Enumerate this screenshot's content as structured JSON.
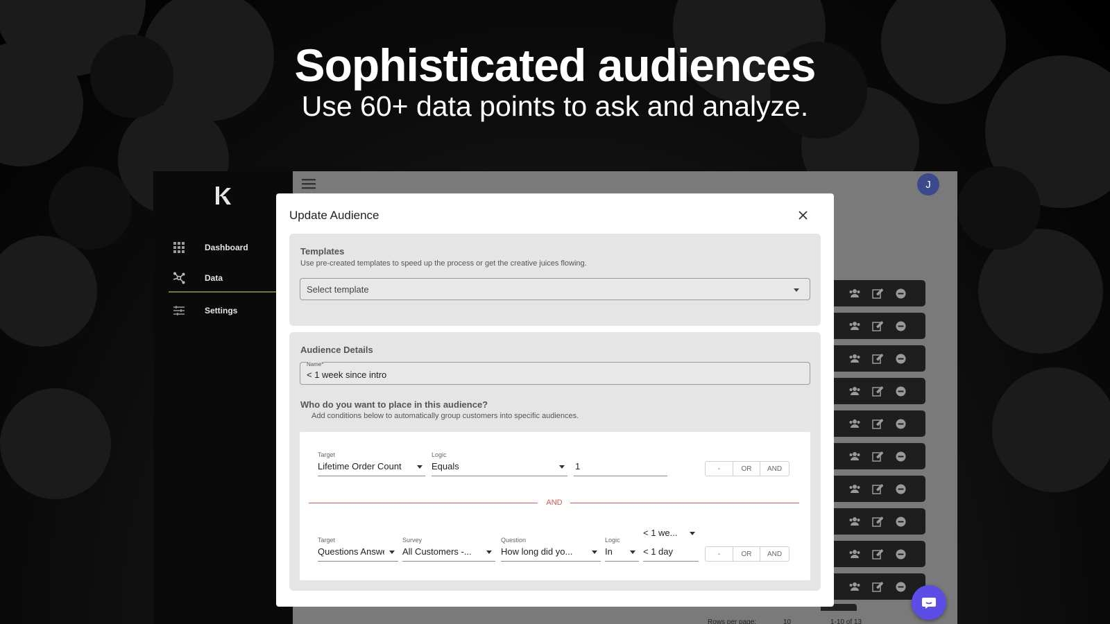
{
  "hero": {
    "title": "Sophisticated audiences",
    "subtitle": "Use 60+ data points to ask and analyze."
  },
  "sidebar": {
    "items": [
      {
        "label": "Dashboard",
        "icon": "dashboard-grid-icon"
      },
      {
        "label": "Data",
        "icon": "data-nodes-icon",
        "active": true
      },
      {
        "label": "Settings",
        "icon": "settings-sliders-icon"
      }
    ]
  },
  "header": {
    "avatar_initial": "J"
  },
  "list_rows": {
    "count": 10,
    "actions": [
      "users-icon",
      "edit-icon",
      "remove-icon"
    ]
  },
  "pagination": {
    "rows_per_page_label": "Rows per page:",
    "rows_per_page_value": "10",
    "range_text": "1-10 of 13"
  },
  "modal": {
    "title": "Update Audience",
    "templates": {
      "title": "Templates",
      "description": "Use pre-created templates to speed up the process or get the creative juices flowing.",
      "placeholder": "Select template"
    },
    "details": {
      "title": "Audience Details",
      "name_label": "Name*",
      "name_value": "< 1 week since intro",
      "question": "Who do you want to place in this audience?",
      "question_desc": "Add conditions below to automatically group customers into specific audiences."
    },
    "condition1": {
      "target_label": "Target",
      "target_value": "Lifetime Order Count",
      "logic_label": "Logic",
      "logic_value": "Equals",
      "value": "1",
      "buttons": [
        "-",
        "OR",
        "AND"
      ]
    },
    "connector": "AND",
    "condition2": {
      "target_label": "Target",
      "target_value": "Questions Answered",
      "survey_label": "Survey",
      "survey_value": "All Customers -...",
      "question_label": "Question",
      "question_value": "How long did yo...",
      "logic_label": "Logic",
      "logic_value": "In",
      "answer_select": "< 1 we...",
      "answer_value": "< 1 day",
      "buttons": [
        "-",
        "OR",
        "AND"
      ]
    }
  },
  "colors": {
    "accent_purple": "#5b4de6",
    "avatar_blue": "#3a4a8a",
    "connector_red": "#d9534f",
    "active_underline": "#6c7a3d"
  }
}
